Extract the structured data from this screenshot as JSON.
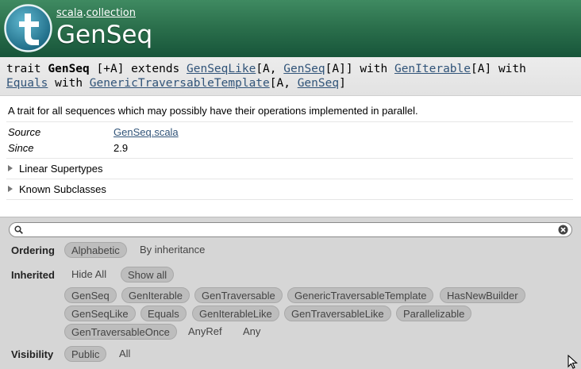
{
  "header": {
    "package_parts": [
      "scala",
      "collection"
    ],
    "package_sep": ".",
    "title": "GenSeq"
  },
  "signature": {
    "kw_trait": "trait",
    "name": "GenSeq",
    "tparams": "[+A]",
    "kw_extends": "extends",
    "parent1": "GenSeqLike",
    "p1a": "[A,",
    "parent1_arg": "GenSeq",
    "p1b": "[A]]",
    "kw_with1": "with",
    "parent2": "GenIterable",
    "p2": "[A]",
    "kw_with2": "with",
    "parent3": "Equals",
    "kw_with3": "with",
    "parent4": "GenericTraversableTemplate",
    "p4a": "[A,",
    "parent4_arg": "GenSeq",
    "p4b": "]"
  },
  "comment": {
    "description": "A trait for all sequences which may possibly have their operations implemented in parallel.",
    "attrs": [
      {
        "key": "Source",
        "value": "GenSeq.scala"
      },
      {
        "key": "Since",
        "value": "2.9"
      }
    ],
    "linear_supertypes": "Linear Supertypes",
    "known_subclasses": "Known Subclasses"
  },
  "filter": {
    "search_placeholder": "",
    "ordering_label": "Ordering",
    "ordering_options": [
      "Alphabetic",
      "By inheritance"
    ],
    "inherited_label": "Inherited",
    "hide_all": "Hide All",
    "show_all": "Show all",
    "inherited_row1": [
      "GenSeq",
      "GenIterable",
      "GenTraversable",
      "GenericTraversableTemplate",
      "HasNewBuilder"
    ],
    "inherited_row2": [
      "GenSeqLike",
      "Equals",
      "GenIterableLike",
      "GenTraversableLike",
      "Parallelizable"
    ],
    "inherited_row3_on": [
      "GenTraversableOnce"
    ],
    "inherited_row3_off": [
      "AnyRef",
      "Any"
    ],
    "visibility_label": "Visibility",
    "visibility_options": [
      "Public",
      "All"
    ]
  },
  "colors": {
    "header_green": "#2a6e4b",
    "link": "#315479",
    "filter_bg": "#d6d6d6",
    "pill_on": "#bdbdbd"
  },
  "icons": [
    "trait-logo-icon",
    "search-icon",
    "clear-search-icon",
    "expand-triangle-icon",
    "mouse-cursor-icon"
  ]
}
